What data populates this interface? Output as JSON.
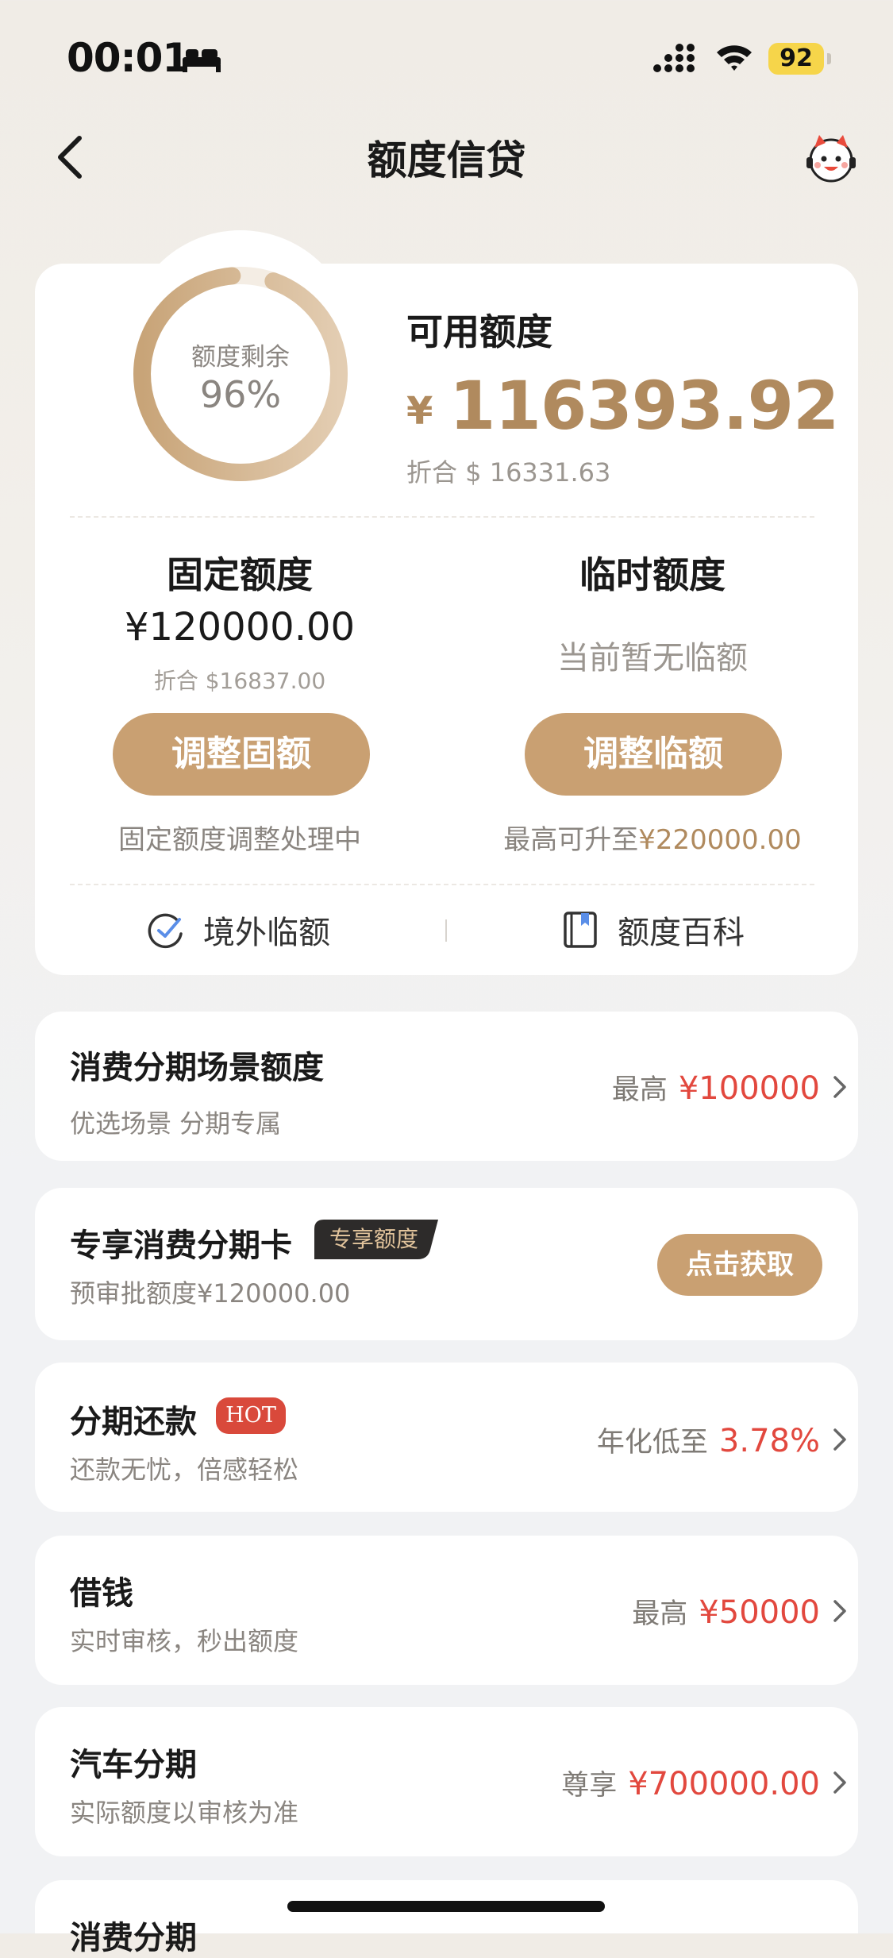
{
  "status_bar": {
    "time": "00:01",
    "sleep_icon": "bed-icon",
    "battery_level": "92"
  },
  "nav": {
    "title": "额度信贷",
    "back_icon": "chevron-left-icon",
    "avatar_icon": "mascot-avatar-icon"
  },
  "summary": {
    "remaining_label": "额度剩余",
    "remaining_percent": "96%",
    "remaining_fraction": 0.96,
    "available_title": "可用额度",
    "available_currency": "¥",
    "available_amount": "116393.92",
    "available_usd": "折合 $ 16331.63"
  },
  "fixed_limit": {
    "title": "固定额度",
    "amount": "¥120000.00",
    "usd": "折合 $16837.00",
    "button": "调整固额",
    "note": "固定额度调整处理中"
  },
  "temp_limit": {
    "title": "临时额度",
    "status": "当前暂无临额",
    "button": "调整临额",
    "note_prefix": "最高可升至",
    "note_amount": "¥220000.00"
  },
  "quick_links": {
    "overseas": "境外临额",
    "wiki": "额度百科"
  },
  "cards": {
    "installment_scene": {
      "title": "消费分期场景额度",
      "subtitle": "优选场景 分期专属",
      "right_label": "最高",
      "right_value": "¥100000"
    },
    "exclusive_card": {
      "title": "专享消费分期卡",
      "badge": "专享额度",
      "subtitle": "预审批额度¥120000.00",
      "button": "点击获取"
    },
    "installment_repay": {
      "title": "分期还款",
      "badge": "HOT",
      "subtitle": "还款无忧，倍感轻松",
      "right_label": "年化低至",
      "right_value": "3.78%"
    },
    "borrow": {
      "title": "借钱",
      "subtitle": "实时审核，秒出额度",
      "right_label": "最高",
      "right_value": "¥50000"
    },
    "car_installment": {
      "title": "汽车分期",
      "subtitle": "实际额度以审核为准",
      "right_label": "尊享",
      "right_value": "¥700000.00"
    },
    "consumer_installment": {
      "title": "消费分期"
    }
  },
  "colors": {
    "gold": "#b08a5e",
    "button_gold": "#c9a072",
    "red": "#e2483e",
    "hot_badge": "#d9493b"
  }
}
